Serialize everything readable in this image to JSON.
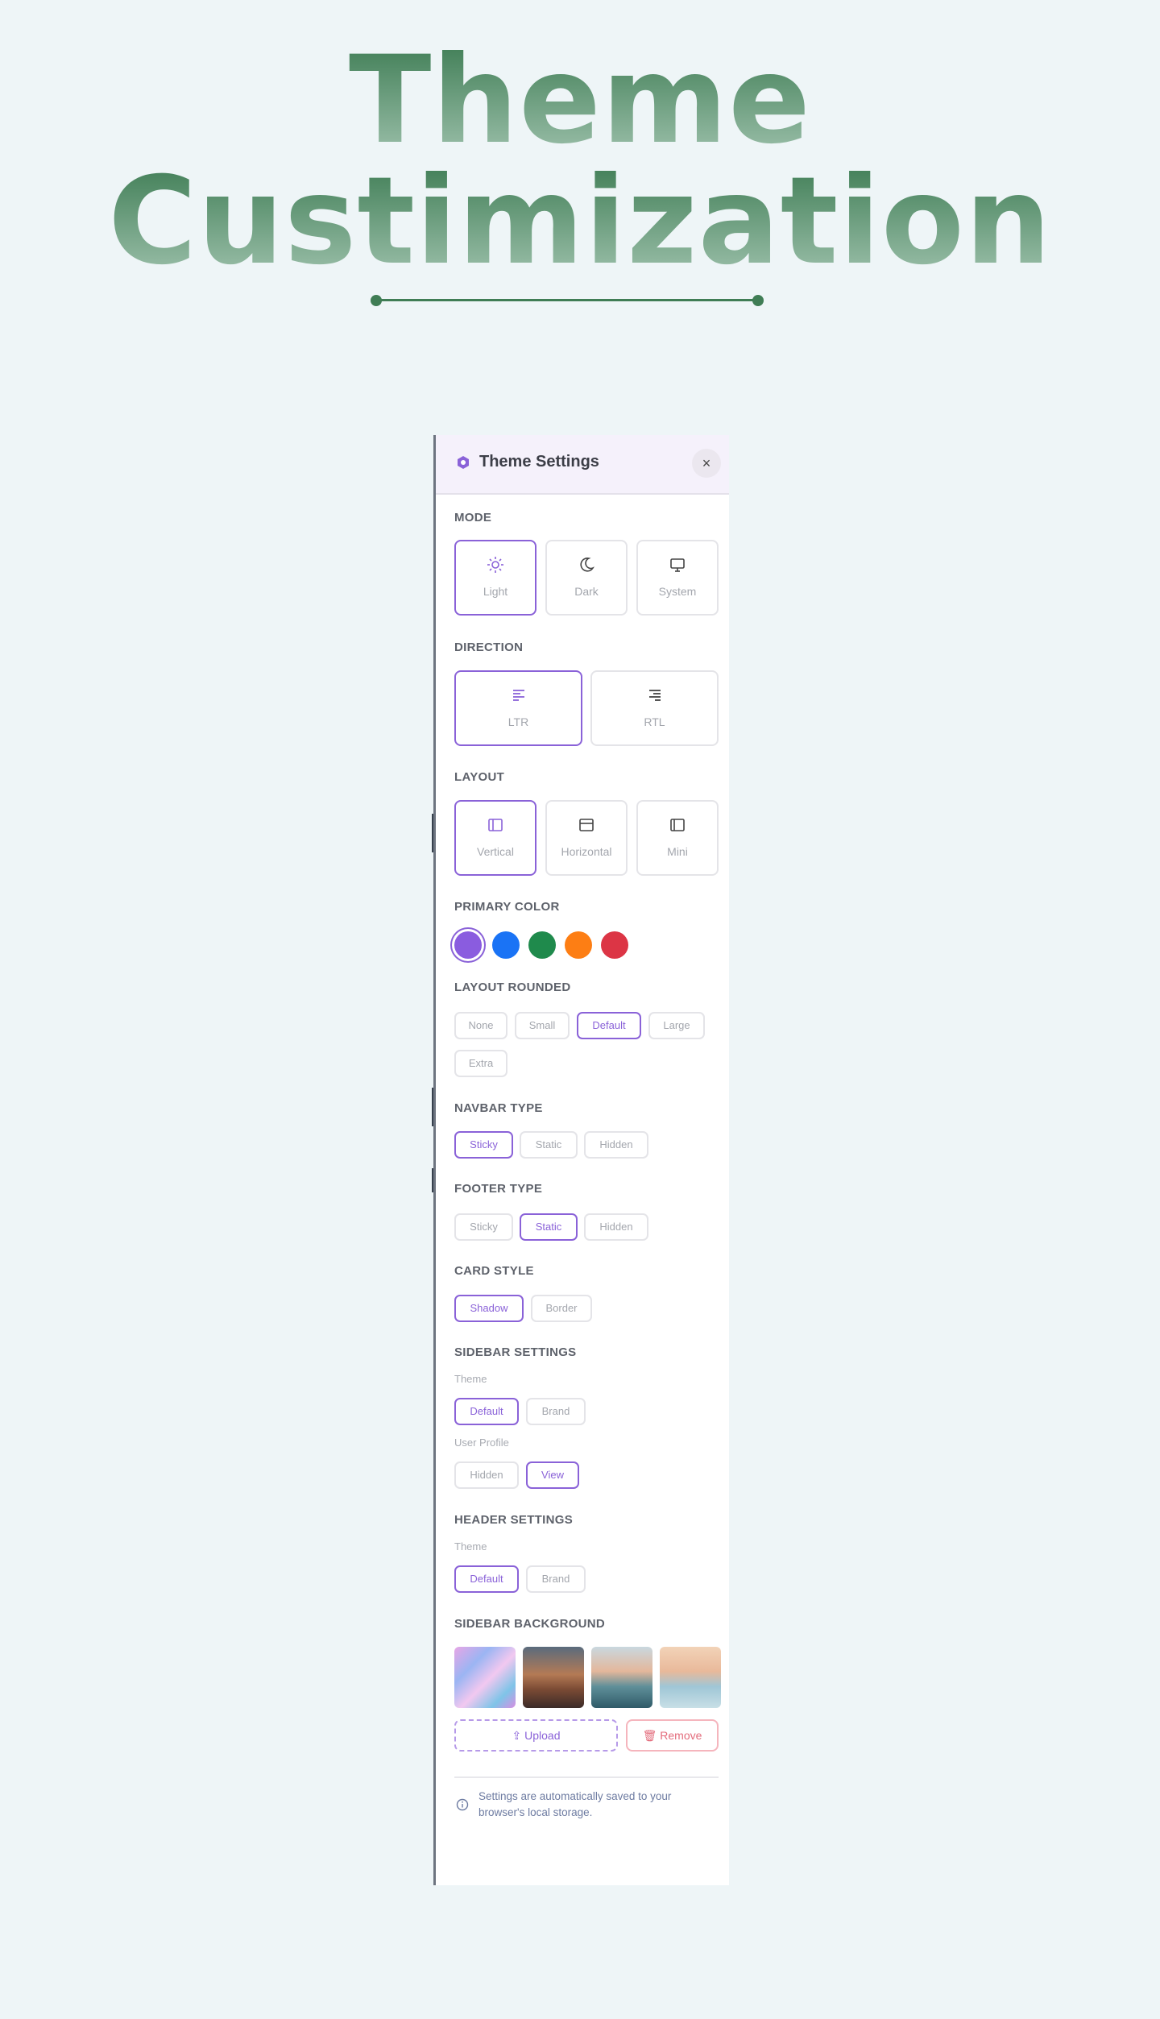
{
  "hero": {
    "line1": "Theme",
    "line2": "Custimization"
  },
  "panel": {
    "title": "Theme Settings",
    "close_label": "×",
    "sections": {
      "mode": "MODE",
      "direction": "DIRECTION",
      "layout": "LAYOUT",
      "primary_color": "PRIMARY COLOR",
      "layout_rounded": "LAYOUT ROUNDED",
      "navbar_type": "NAVBAR TYPE",
      "footer_type": "FOOTER TYPE",
      "card_style": "CARD STYLE",
      "sidebar_settings": "SIDEBAR SETTINGS",
      "header_settings": "HEADER SETTINGS",
      "sidebar_background": "SIDEBAR BACKGROUND"
    },
    "mode": {
      "options": [
        {
          "label": "Light",
          "icon": "sun-icon"
        },
        {
          "label": "Dark",
          "icon": "moon-icon"
        },
        {
          "label": "System",
          "icon": "monitor-icon"
        }
      ],
      "selected": "Light"
    },
    "direction": {
      "options": [
        {
          "label": "LTR",
          "icon": "align-left-icon"
        },
        {
          "label": "RTL",
          "icon": "align-right-icon"
        }
      ],
      "selected": "LTR"
    },
    "layout": {
      "options": [
        {
          "label": "Vertical",
          "icon": "sidebar-layout-icon"
        },
        {
          "label": "Horizontal",
          "icon": "top-bar-layout-icon"
        },
        {
          "label": "Mini",
          "icon": "mini-sidebar-layout-icon"
        }
      ],
      "selected": "Vertical"
    },
    "primary_colors": [
      "#8a5cdf",
      "#1a73f5",
      "#1f8a4c",
      "#fd7e14",
      "#dc3545"
    ],
    "primary_selected": "#8a5cdf",
    "rounded": {
      "options": [
        "None",
        "Small",
        "Default",
        "Large",
        "Extra"
      ],
      "selected": "Default"
    },
    "navbar": {
      "options": [
        "Sticky",
        "Static",
        "Hidden"
      ],
      "selected": "Sticky"
    },
    "footer": {
      "options": [
        "Sticky",
        "Static",
        "Hidden"
      ],
      "selected": "Static"
    },
    "card": {
      "options": [
        "Shadow",
        "Border"
      ],
      "selected": "Shadow"
    },
    "sidebar_settings": {
      "theme_label": "Theme",
      "theme_options": [
        "Default",
        "Brand"
      ],
      "theme_selected": "Default",
      "profile_label": "User Profile",
      "profile_options": [
        "Hidden",
        "View"
      ],
      "profile_selected": "View"
    },
    "header_settings": {
      "theme_label": "Theme",
      "theme_options": [
        "Default",
        "Brand"
      ],
      "theme_selected": "Default"
    },
    "backgrounds": [
      "marble-pastel",
      "desert-road",
      "mountain-lake",
      "beach-sunset"
    ],
    "upload_label": "Upload",
    "remove_label": "Remove",
    "footer_note": "Settings are automatically saved to your browser's local storage.",
    "accent": "#8a62d8"
  }
}
